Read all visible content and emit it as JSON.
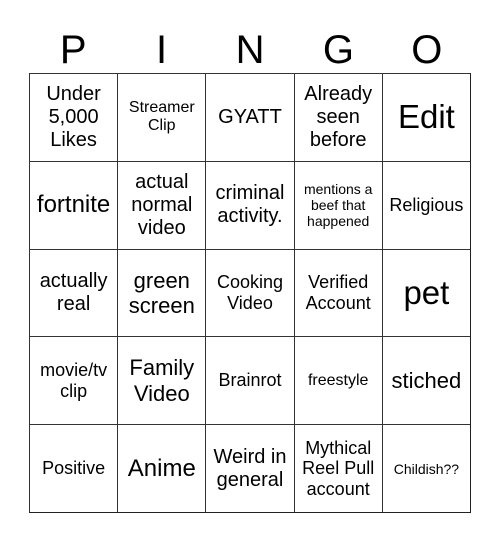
{
  "card": {
    "header": [
      "P",
      "I",
      "N",
      "G",
      "O"
    ],
    "cells": [
      [
        "Under 5,000 Likes",
        "Streamer Clip",
        "GYATT",
        "Already seen before",
        "Edit"
      ],
      [
        "fortnite",
        "actual normal video",
        "criminal activity.",
        "mentions a beef that happened",
        "Religious"
      ],
      [
        "actually real",
        "green screen",
        "Cooking Video",
        "Verified Account",
        "pet"
      ],
      [
        "movie/tv clip",
        "Family Video",
        "Brainrot",
        "freestyle",
        "stiched"
      ],
      [
        "Positive",
        "Anime",
        "Weird in general",
        "Mythical Reel Pull account",
        "Childish??"
      ]
    ]
  }
}
